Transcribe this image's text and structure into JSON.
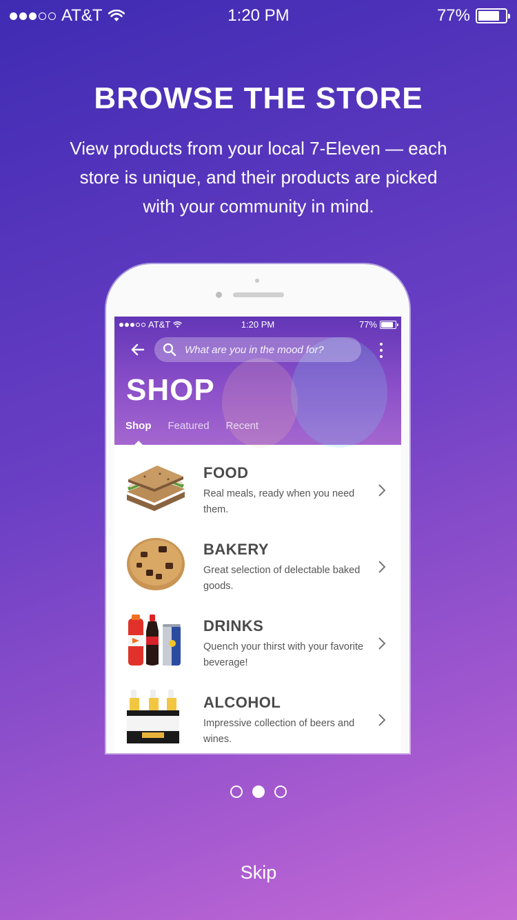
{
  "status_bar": {
    "carrier": "AT&T",
    "time": "1:20 PM",
    "battery": "77%"
  },
  "onboarding": {
    "title": "BROWSE THE STORE",
    "subtitle": "View products from your local 7-Eleven — each store is unique, and their products are picked with your community in mind."
  },
  "mockup": {
    "status_bar": {
      "carrier": "AT&T",
      "time": "1:20 PM",
      "battery": "77%"
    },
    "search": {
      "placeholder": "What are you in the mood for?"
    },
    "title": "SHOP",
    "tabs": [
      {
        "label": "Shop",
        "active": true
      },
      {
        "label": "Featured",
        "active": false
      },
      {
        "label": "Recent",
        "active": false
      }
    ],
    "categories": [
      {
        "name": "FOOD",
        "description": "Real meals, ready when you need them.",
        "icon": "sandwich-icon"
      },
      {
        "name": "BAKERY",
        "description": "Great selection of delectable baked goods.",
        "icon": "cookie-icon"
      },
      {
        "name": "DRINKS",
        "description": "Quench your thirst with your favorite beverage!",
        "icon": "drinks-icon"
      },
      {
        "name": "ALCOHOL",
        "description": "Impressive collection of beers and wines.",
        "icon": "beer-pack-icon"
      }
    ]
  },
  "pager": {
    "total": 3,
    "current": 2
  },
  "skip_label": "Skip"
}
